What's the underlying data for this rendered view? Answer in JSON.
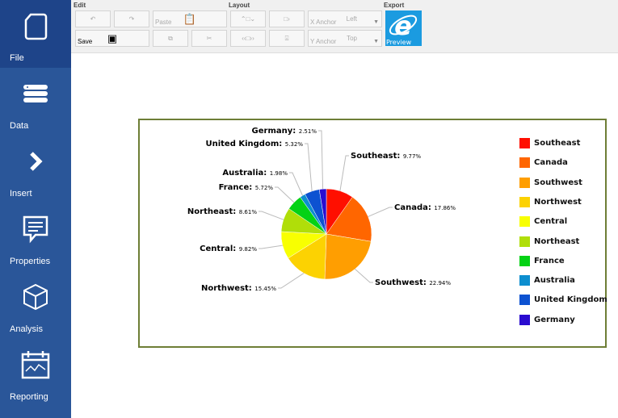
{
  "sidebar": {
    "items": [
      {
        "label": "File",
        "icon": "file-icon",
        "active": true
      },
      {
        "label": "Data",
        "icon": "database-icon"
      },
      {
        "label": "Insert",
        "icon": "chevron-right-icon"
      },
      {
        "label": "Properties",
        "icon": "comment-icon"
      },
      {
        "label": "Analysis",
        "icon": "cube-icon"
      },
      {
        "label": "Reporting",
        "icon": "calendar-chart-icon"
      }
    ]
  },
  "toolbar": {
    "edit_label": "Edit",
    "layout_label": "Layout",
    "export_label": "Export",
    "paste_label": "Paste",
    "save_label": "Save",
    "preview_label": "Preview",
    "x_anchor": {
      "label": "X Anchor",
      "value": "Left"
    },
    "y_anchor": {
      "label": "Y Anchor",
      "value": "Top"
    }
  },
  "chart_data": {
    "type": "pie",
    "start": "top",
    "direction": "clockwise",
    "slices": [
      {
        "name": "Southeast",
        "value": 9.77,
        "label": "9.77%",
        "color": "#ff0f00"
      },
      {
        "name": "Canada",
        "value": 17.86,
        "label": "17.86%",
        "color": "#ff6600"
      },
      {
        "name": "Southwest",
        "value": 22.94,
        "label": "22.94%",
        "color": "#ff9e01"
      },
      {
        "name": "Northwest",
        "value": 15.45,
        "label": "15.45%",
        "color": "#fcd202"
      },
      {
        "name": "Central",
        "value": 9.82,
        "label": "9.82%",
        "color": "#f8ff01"
      },
      {
        "name": "Northeast",
        "value": 8.61,
        "label": "8.61%",
        "color": "#b0de09"
      },
      {
        "name": "France",
        "value": 5.72,
        "label": "5.72%",
        "color": "#04d215"
      },
      {
        "name": "Australia",
        "value": 1.98,
        "label": "1.98%",
        "color": "#0d8ecf"
      },
      {
        "name": "United Kingdom",
        "value": 5.32,
        "label": "5.32%",
        "color": "#0d52d1"
      },
      {
        "name": "Germany",
        "value": 2.51,
        "label": "2.51%",
        "color": "#2a0cd0"
      }
    ],
    "legend": "right"
  }
}
